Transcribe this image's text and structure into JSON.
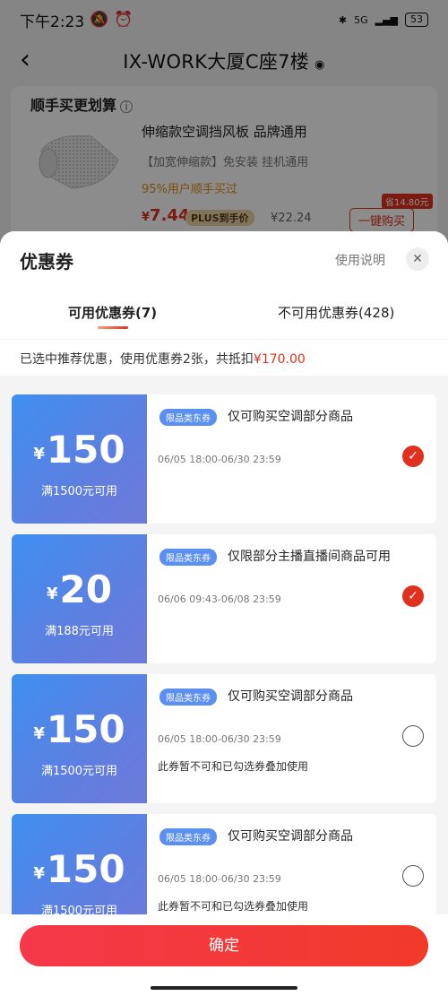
{
  "status_bar": {
    "time": "下午2:23",
    "network": "5G",
    "battery": "53"
  },
  "nav": {
    "title": "IX-WORK大厦C座7楼",
    "pin_icon": "location-pin-icon"
  },
  "promo": {
    "heading": "顺手买更划算",
    "product_name": "伸缩款空调挡风板 品牌通用",
    "product_sub": "【加宽伸缩款】免安装 挂机通用",
    "product_stat": "95%用户顺手买过",
    "price_symbol": "¥",
    "price": "7.44",
    "plus_label": "PLUS到手价",
    "orig_price": "¥22.24",
    "save_tag": "省14.80元",
    "buy_label": "一键购买"
  },
  "sheet": {
    "title": "优惠券",
    "usage_label": "使用说明",
    "tabs": {
      "available": "可用优惠券(7)",
      "unavailable": "不可用优惠券(428)"
    },
    "summary": {
      "text": "已选中推荐优惠，使用优惠券2张，共抵扣",
      "amount": "¥170.00"
    }
  },
  "coupons": [
    {
      "amount": "150",
      "yen": "¥",
      "condition": "满1500元可用",
      "tag": "限品类东券",
      "scope": "仅可购买空调部分商品",
      "validity": "06/05 18:00-06/30 23:59",
      "note": "",
      "selected": true
    },
    {
      "amount": "20",
      "yen": "¥",
      "condition": "满188元可用",
      "tag": "限品类东券",
      "scope": "仅限部分主播直播间商品可用",
      "validity": "06/06 09:43-06/08 23:59",
      "note": "",
      "selected": true
    },
    {
      "amount": "150",
      "yen": "¥",
      "condition": "满1500元可用",
      "tag": "限品类东券",
      "scope": "仅可购买空调部分商品",
      "validity": "06/05 18:00-06/30 23:59",
      "note": "此券暂不可和已勾选券叠加使用",
      "selected": false
    },
    {
      "amount": "150",
      "yen": "¥",
      "condition": "满1500元可用",
      "tag": "限品类东券",
      "scope": "仅可购买空调部分商品",
      "validity": "06/05 18:00-06/30 23:59",
      "note": "此券暂不可和已勾选券叠加使用",
      "selected": false
    }
  ],
  "footer": {
    "confirm_label": "确定"
  },
  "colors": {
    "accent_red": "#e0301e",
    "coupon_blue": "#4a8af0",
    "confirm_red": "#f23a2a"
  }
}
